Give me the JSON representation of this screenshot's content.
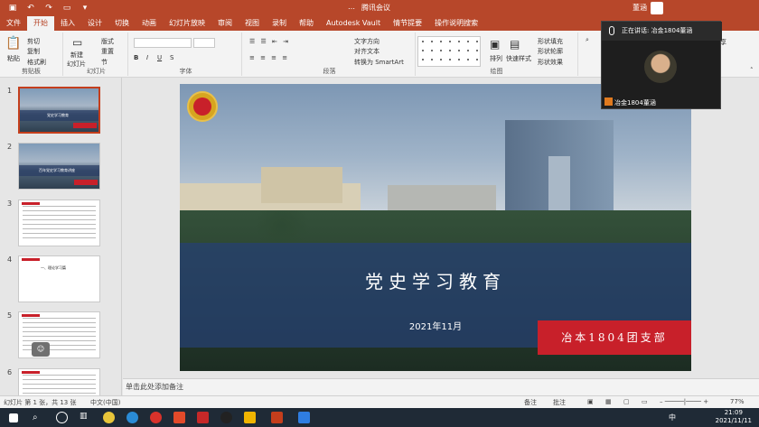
{
  "titlebar": {
    "window_title": "…",
    "meeting_app": "腾讯会议",
    "user": "董涵"
  },
  "tabs": [
    "文件",
    "开始",
    "插入",
    "设计",
    "切换",
    "动画",
    "幻灯片放映",
    "审阅",
    "视图",
    "录制",
    "帮助",
    "Autodesk Vault",
    "情节提要",
    "操作说明搜索"
  ],
  "share_label": "共享",
  "ribbon": {
    "clipboard": {
      "paste": "粘贴",
      "cut": "剪切",
      "copy": "复制",
      "format_painter": "格式刷",
      "label": "剪贴板"
    },
    "slides": {
      "new_slide": "新建",
      "new_slide2": "幻灯片",
      "layout": "版式",
      "reset": "重置",
      "section": "节",
      "label": "幻灯片"
    },
    "font": {
      "label": "字体"
    },
    "paragraph": {
      "text_direction": "文字方向",
      "align_text": "对齐文本",
      "smartart": "转换为 SmartArt",
      "label": "段落"
    },
    "drawing": {
      "arrange": "排列",
      "quick_styles": "快速样式",
      "fill": "形状填充",
      "outline": "形状轮廓",
      "effects": "形状效果",
      "label": "绘图"
    }
  },
  "thumbnails": [
    {
      "num": "1",
      "caption": "党史学习教育"
    },
    {
      "num": "2",
      "caption": "百年党史学习教育讲座"
    },
    {
      "num": "3"
    },
    {
      "num": "4",
      "caption": "一、理论学习篇"
    },
    {
      "num": "5"
    },
    {
      "num": "6"
    }
  ],
  "slide": {
    "title": "党史学习教育",
    "date": "2021年11月",
    "org": "冶本1804团支部"
  },
  "notes_placeholder": "单击此处添加备注",
  "status": {
    "slide_info": "幻灯片 第 1 张，共 13 张",
    "language": "中文(中国)",
    "notes_btn": "备注",
    "comments_btn": "批注",
    "zoom": "77%"
  },
  "meeting": {
    "speaking": "正在讲话: 冶金1804董涵",
    "participant": "冶金1804董涵"
  },
  "clock": {
    "time": "21:09",
    "date": "2021/11/11"
  },
  "taskbar": {
    "ime": "中"
  },
  "colors": {
    "accent": "#b7472a",
    "banner": "#254075",
    "red": "#c8202a"
  }
}
